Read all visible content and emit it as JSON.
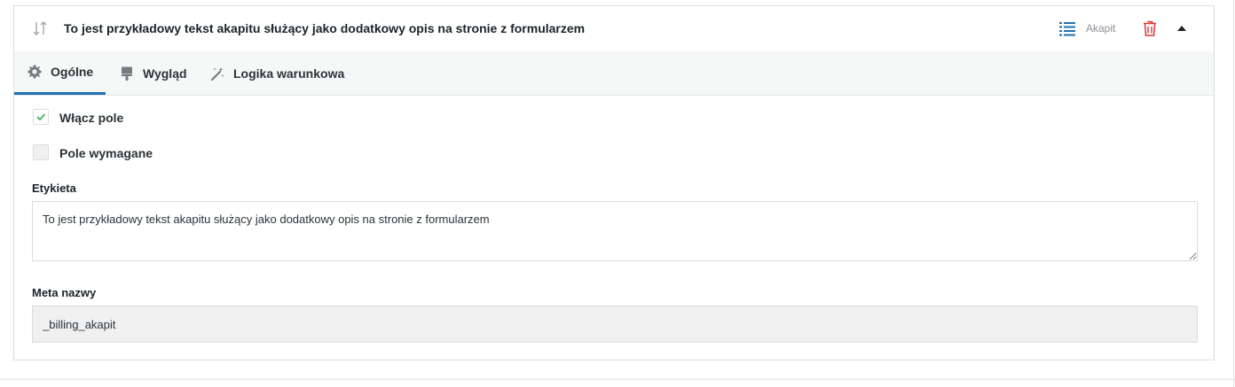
{
  "field": {
    "title": "To jest przykładowy tekst akapitu służący jako dodatkowy opis na stronie z formularzem",
    "type_label": "Akapit"
  },
  "tabs": [
    {
      "label": "Ogólne",
      "icon": "gear-icon",
      "active": true
    },
    {
      "label": "Wygląd",
      "icon": "brush-icon",
      "active": false
    },
    {
      "label": "Logika warunkowa",
      "icon": "magic-wand-icon",
      "active": false
    }
  ],
  "options": {
    "enable_label": "Włącz pole",
    "enable_checked": true,
    "required_label": "Pole wymagane",
    "required_checked": false
  },
  "label_field": {
    "label": "Etykieta",
    "value": "To jest przykładowy tekst akapitu służący jako dodatkowy opis na stronie z formularzem"
  },
  "meta_field": {
    "label": "Meta nazwy",
    "value": "_billing_akapit"
  },
  "colors": {
    "accent": "#2271b1",
    "delete": "#d63638",
    "check": "#46b450"
  }
}
